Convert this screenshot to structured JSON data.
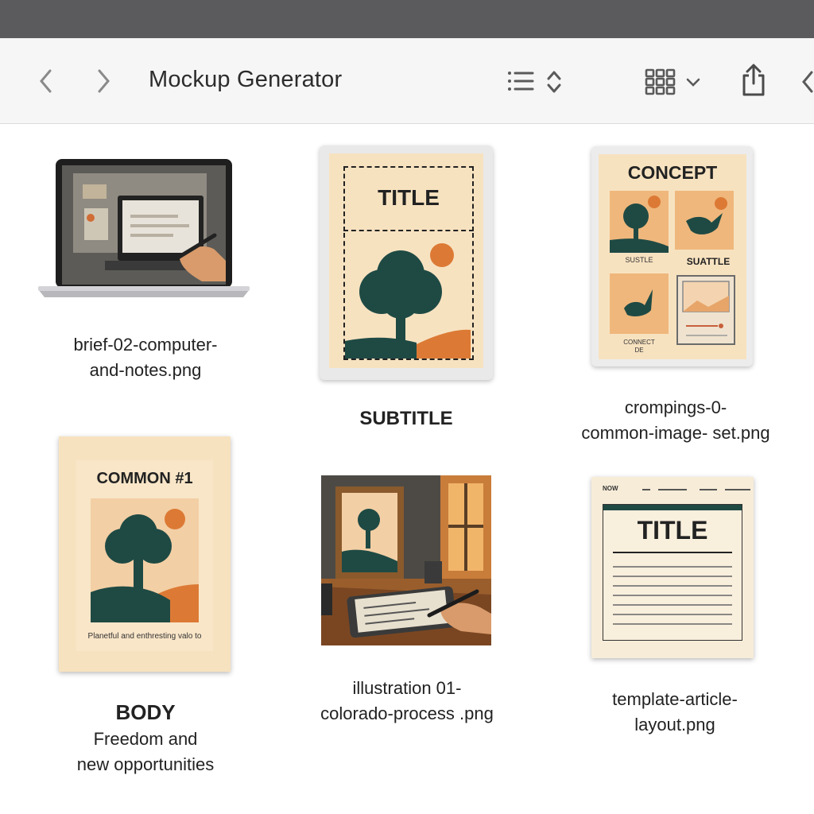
{
  "window": {
    "title": "Mockup Generator",
    "icons": {
      "back": "chevron-left-icon",
      "forward": "chevron-right-icon",
      "list_view": "list-view-icon",
      "sort": "sort-updown-icon",
      "grid_view": "grid-view-icon",
      "view_menu": "chevron-down-icon",
      "share": "share-icon",
      "overflow": "chevron-left-icon"
    }
  },
  "files": [
    {
      "caption_line1": "brief-02-computer-",
      "caption_line2": "and-notes.png",
      "thumb": "laptop-with-hand"
    },
    {
      "thumb_title": "TITLE",
      "caption": "SUBTITLE",
      "thumb": "title-tree-poster"
    },
    {
      "thumb_title": "CONCEPT",
      "thumb_label1": "SUSTLE",
      "thumb_label2": "SUATTLE",
      "thumb_label3": "CONNECT",
      "thumb_label4": "DE",
      "caption_line1": "crompings-0-",
      "caption_line2": "common-image- set.png",
      "thumb": "concept-grid"
    },
    {
      "thumb_title": "COMMON #1",
      "thumb_text": "Planetful and enthresting valo to",
      "caption": "BODY",
      "caption_line1": "Freedom and",
      "caption_line2": "new opportunities",
      "thumb": "common-poster"
    },
    {
      "caption_line1": "illustration 01-",
      "caption_line2": "colorado-process .png",
      "thumb": "desk-illustration"
    },
    {
      "thumb_small": "NOW",
      "thumb_title": "TITLE",
      "caption_line1": "template-article-",
      "caption_line2": "layout.png",
      "thumb": "article-template"
    }
  ],
  "colors": {
    "titlebar": "#5b5b5d",
    "cream": "#f7e2c0",
    "tree_green": "#1f4a44",
    "orange": "#dc7a35"
  }
}
